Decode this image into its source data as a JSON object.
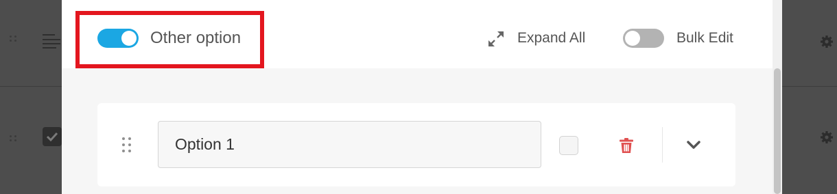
{
  "header": {
    "other_option": {
      "label": "Other option",
      "enabled": true
    },
    "expand_all": {
      "label": "Expand All"
    },
    "bulk_edit": {
      "label": "Bulk Edit",
      "enabled": false
    }
  },
  "options": [
    {
      "value": "Option 1",
      "checked": false
    }
  ],
  "colors": {
    "toggle_on": "#1ba7e3",
    "toggle_off": "#b3b3b3",
    "highlight": "#e3161f",
    "delete": "#e05050"
  },
  "icons": {
    "expand": "expand-arrows-icon",
    "delete": "trash-icon",
    "drag": "drag-handle-icon",
    "collapse": "chevron-down-icon"
  }
}
